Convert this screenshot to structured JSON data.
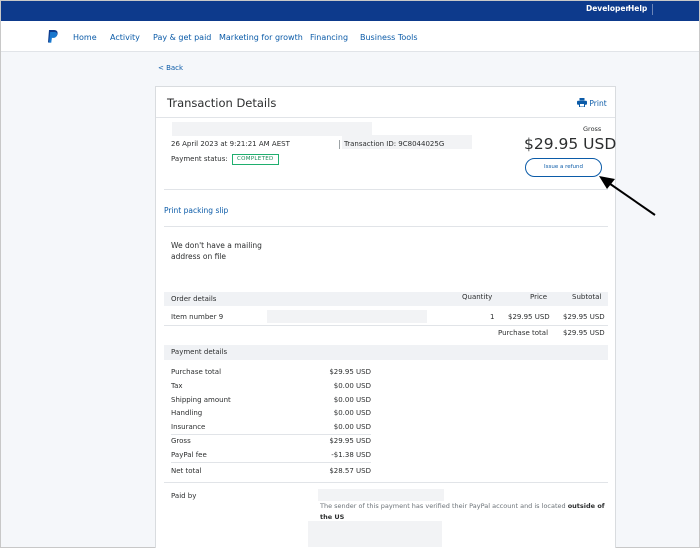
{
  "topbar": {
    "developer": "Developer",
    "help": "Help"
  },
  "nav": [
    "Home",
    "Activity",
    "Pay & get paid",
    "Marketing for growth",
    "Financing",
    "Business Tools"
  ],
  "back_label": "< Back",
  "card": {
    "title": "Transaction Details",
    "print_label": "Print",
    "datetime": "26 April 2023 at 9:21:21 AM AEST",
    "transaction_id_label": "Transaction ID: 9C8044025G",
    "payment_status_label": "Payment status:",
    "payment_status_value": "COMPLETED",
    "gross_label": "Gross",
    "amount": "$29.95 USD",
    "refund_button": "Issue a refund",
    "print_packing_slip": "Print packing slip",
    "mailing_note": "We don't have a mailing address on file"
  },
  "order": {
    "headers": {
      "details": "Order details",
      "quantity": "Quantity",
      "price": "Price",
      "subtotal": "Subtotal"
    },
    "item": {
      "name": "Item number 9",
      "quantity": "1",
      "price": "$29.95 USD",
      "subtotal": "$29.95 USD"
    },
    "purchase_total_label": "Purchase total",
    "purchase_total_value": "$29.95 USD"
  },
  "payment_details": {
    "header": "Payment details",
    "rows": [
      {
        "label": "Purchase total",
        "value": "$29.95 USD"
      },
      {
        "label": "Tax",
        "value": "$0.00 USD"
      },
      {
        "label": "Shipping amount",
        "value": "$0.00 USD"
      },
      {
        "label": "Handling",
        "value": "$0.00 USD"
      },
      {
        "label": "Insurance",
        "value": "$0.00 USD"
      },
      {
        "label": "Gross",
        "value": "$29.95 USD"
      },
      {
        "label": "PayPal fee",
        "value": "-$1.38 USD"
      },
      {
        "label": "Net total",
        "value": "$28.57 USD"
      }
    ]
  },
  "paid_by": {
    "label": "Paid by",
    "note_prefix": "The sender of this payment has verified their PayPal account and is located ",
    "note_bold": "outside of the US"
  },
  "colors": {
    "topbar": "#0d3a8c",
    "link": "#0b5ba8",
    "status": "#1fae6e"
  }
}
